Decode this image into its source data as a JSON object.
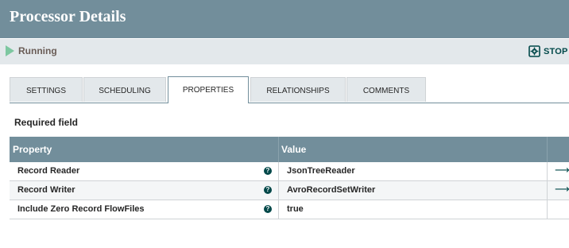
{
  "dialog": {
    "title": "Processor Details"
  },
  "status": {
    "label": "Running",
    "icon": "play-icon",
    "color": "#7dc7a0"
  },
  "toolbar": {
    "stop_label": "STOP &"
  },
  "tabs": [
    {
      "label": "SETTINGS",
      "active": false
    },
    {
      "label": "SCHEDULING",
      "active": false
    },
    {
      "label": "PROPERTIES",
      "active": true
    },
    {
      "label": "RELATIONSHIPS",
      "active": false
    },
    {
      "label": "COMMENTS",
      "active": false
    }
  ],
  "required_field_label": "Required field",
  "grid": {
    "columns": {
      "property": "Property",
      "value": "Value"
    },
    "rows": [
      {
        "name": "Record Reader",
        "value": "JsonTreeReader",
        "has_goto": true
      },
      {
        "name": "Record Writer",
        "value": "AvroRecordSetWriter",
        "has_goto": true
      },
      {
        "name": "Include Zero Record FlowFiles",
        "value": "true",
        "has_goto": false
      }
    ]
  },
  "icons": {
    "help": "question-circle-icon",
    "goto": "arrow-right-icon",
    "stop": "gear-stop-icon"
  },
  "colors": {
    "header": "#728e9b",
    "statusbar": "#e3e8eb",
    "accent": "#004849"
  }
}
